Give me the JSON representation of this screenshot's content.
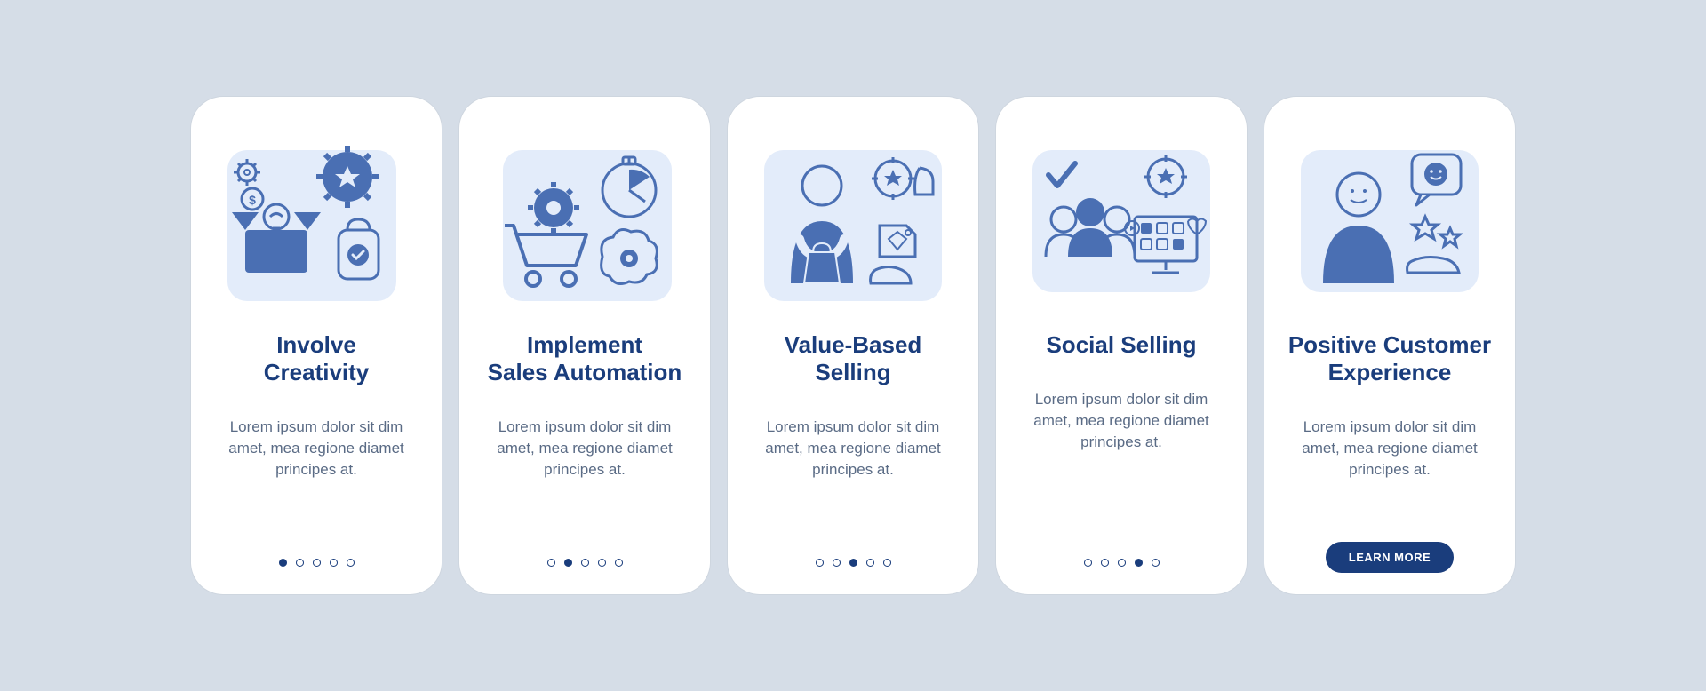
{
  "cards": [
    {
      "title": "Involve\nCreativity",
      "body": "Lorem ipsum dolor sit dim amet, mea regione diamet principes at.",
      "icon_name": "creativity-illustration",
      "active_dot": 0,
      "show_button": false
    },
    {
      "title": "Implement\nSales Automation",
      "body": "Lorem ipsum dolor sit dim amet, mea regione diamet principes at.",
      "icon_name": "automation-illustration",
      "active_dot": 1,
      "show_button": false
    },
    {
      "title": "Value-Based\nSelling",
      "body": "Lorem ipsum dolor sit dim amet, mea regione diamet principes at.",
      "icon_name": "value-illustration",
      "active_dot": 2,
      "show_button": false
    },
    {
      "title": "Social Selling",
      "body": "Lorem ipsum dolor sit dim amet, mea regione diamet principes at.",
      "icon_name": "social-illustration",
      "active_dot": 3,
      "show_button": false
    },
    {
      "title": "Positive Customer\nExperience",
      "body": "Lorem ipsum dolor sit dim amet, mea regione diamet principes at.",
      "icon_name": "customer-illustration",
      "active_dot": 4,
      "show_button": true
    }
  ],
  "dot_count": 5,
  "button_label": "LEARN MORE",
  "colors": {
    "bg": "#d5dde7",
    "card_bg": "#ffffff",
    "title": "#1a3d7c",
    "body": "#5a6b85",
    "illustration_bg": "#e3ecfa",
    "illustration_stroke": "#4a6fb3",
    "illustration_fill": "#4a6fb3",
    "button_bg": "#1a3d7c"
  }
}
